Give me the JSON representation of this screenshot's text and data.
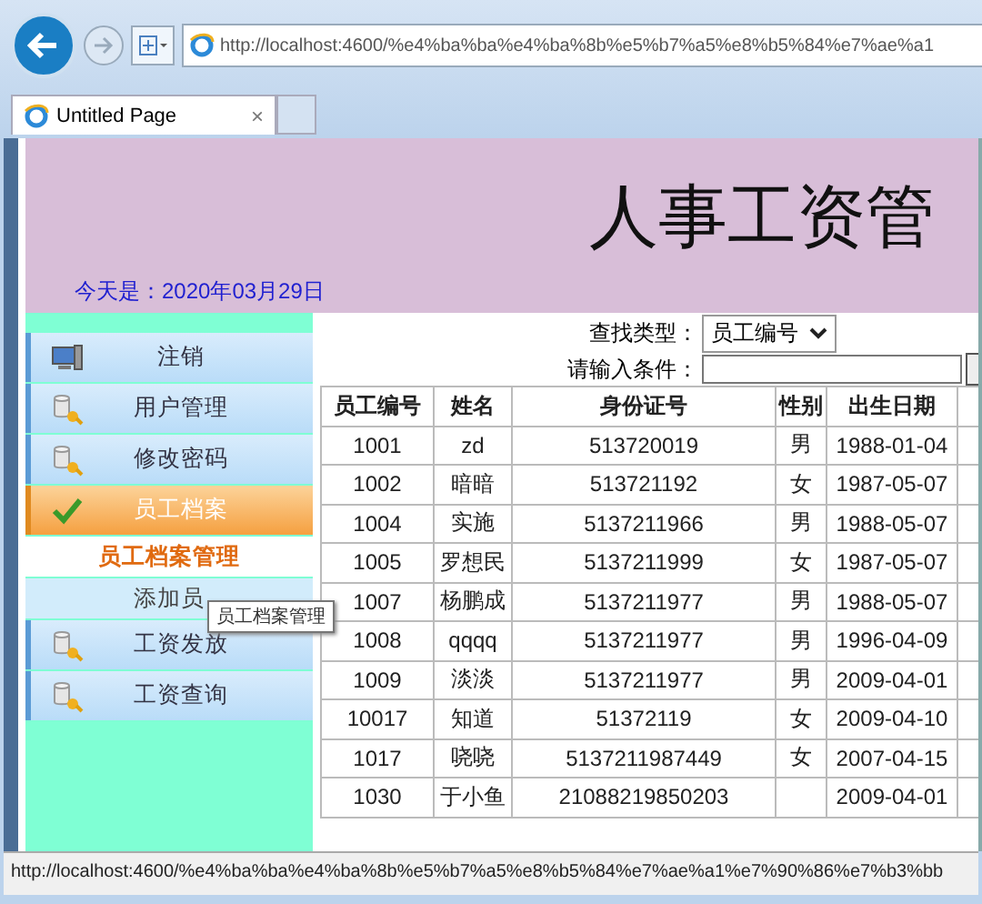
{
  "browser": {
    "address": "http://localhost:4600/%e4%ba%ba%e4%ba%8b%e5%b7%a5%e8%b5%84%e7%ae%a1",
    "tab_title": "Untitled Page",
    "tab_close": "×"
  },
  "header": {
    "title": "人事工资管",
    "date": "今天是：2020年03月29日"
  },
  "menu": [
    {
      "label": "注销",
      "kind": "main",
      "selected": false
    },
    {
      "label": "用户管理",
      "kind": "main",
      "selected": false
    },
    {
      "label": "修改密码",
      "kind": "main",
      "selected": false
    },
    {
      "label": "员工档案",
      "kind": "main",
      "selected": true
    },
    {
      "label": "员工档案管理",
      "kind": "sub",
      "selected": true
    },
    {
      "label": "添加员",
      "kind": "sub",
      "selected": false,
      "tooltip": "员工档案管理"
    },
    {
      "label": "工资发放",
      "kind": "main",
      "selected": false
    },
    {
      "label": "工资查询",
      "kind": "main",
      "selected": false
    }
  ],
  "search": {
    "type_label": "查找类型：",
    "type_value": "员工编号",
    "condition_label": "请输入条件："
  },
  "table": {
    "columns": [
      "员工编号",
      "姓名",
      "身份证号",
      "性别",
      "出生日期"
    ],
    "rows": [
      [
        "1001",
        "zd",
        "513720019",
        "男",
        "1988-01-04"
      ],
      [
        "1002",
        "暗暗",
        "513721192",
        "女",
        "1987-05-07"
      ],
      [
        "1004",
        "实施",
        "5137211966",
        "男",
        "1988-05-07"
      ],
      [
        "1005",
        "罗想民",
        "5137211999",
        "女",
        "1987-05-07"
      ],
      [
        "1007",
        "杨鹏成",
        "5137211977",
        "男",
        "1988-05-07"
      ],
      [
        "1008",
        "qqqq",
        "5137211977",
        "男",
        "1996-04-09"
      ],
      [
        "1009",
        "淡淡",
        "5137211977",
        "男",
        "2009-04-01"
      ],
      [
        "10017",
        "知道",
        "51372119",
        "女",
        "2009-04-10"
      ],
      [
        "1017",
        "哓哓",
        "5137211987449",
        "女",
        "2007-04-15"
      ],
      [
        "1030",
        "于小鱼",
        "21088219850203",
        "",
        "2009-04-01"
      ]
    ]
  },
  "status_bar": "http://localhost:4600/%e4%ba%ba%e4%ba%8b%e5%b7%a5%e8%b5%84%e7%ae%a1%e7%90%86%e7%b3%bb"
}
